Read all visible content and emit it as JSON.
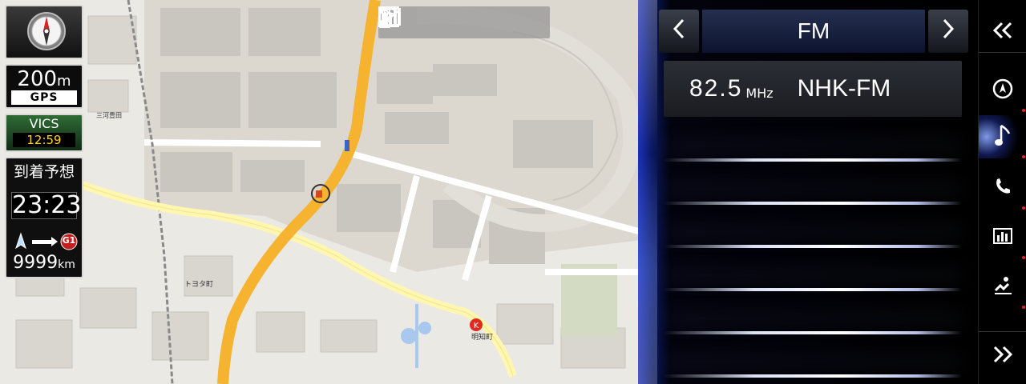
{
  "hud": {
    "scale_value": "200",
    "scale_unit": "m",
    "gps_label": "GPS",
    "vics_label": "VICS",
    "vics_time": "12:59",
    "eta_label": "到着予想",
    "eta_time": "23:23",
    "route_code": "G1",
    "distance_value": "9999",
    "distance_unit": "km"
  },
  "status_icons": [
    "phone-icon",
    "mail-icon",
    "wifi-icon",
    "bluetooth-icon",
    "signal-icon",
    "battery-icon"
  ],
  "map_labels": {
    "landmark": "明知町",
    "town_toyota": "トヨタ町",
    "mikawa": "三河豊田"
  },
  "audio": {
    "band": "FM",
    "prev_icon": "chevron-left-icon",
    "next_icon": "chevron-right-icon",
    "frequency": "82.5",
    "frequency_unit": "MHz",
    "station": "NHK-FM",
    "preset_count": 6
  },
  "rail": {
    "collapse_icon": "double-chevron-left-icon",
    "expand_icon": "double-chevron-right-icon",
    "items": [
      "navigation-icon",
      "music-note-icon",
      "phone-icon",
      "equalizer-icon",
      "climate-icon"
    ],
    "selected": "music-note-icon"
  },
  "colors": {
    "highway": "#f5b330",
    "main_road": "#fff6b0",
    "panel_accent": "#1b2fb7",
    "vics_time": "#ffd21f"
  }
}
